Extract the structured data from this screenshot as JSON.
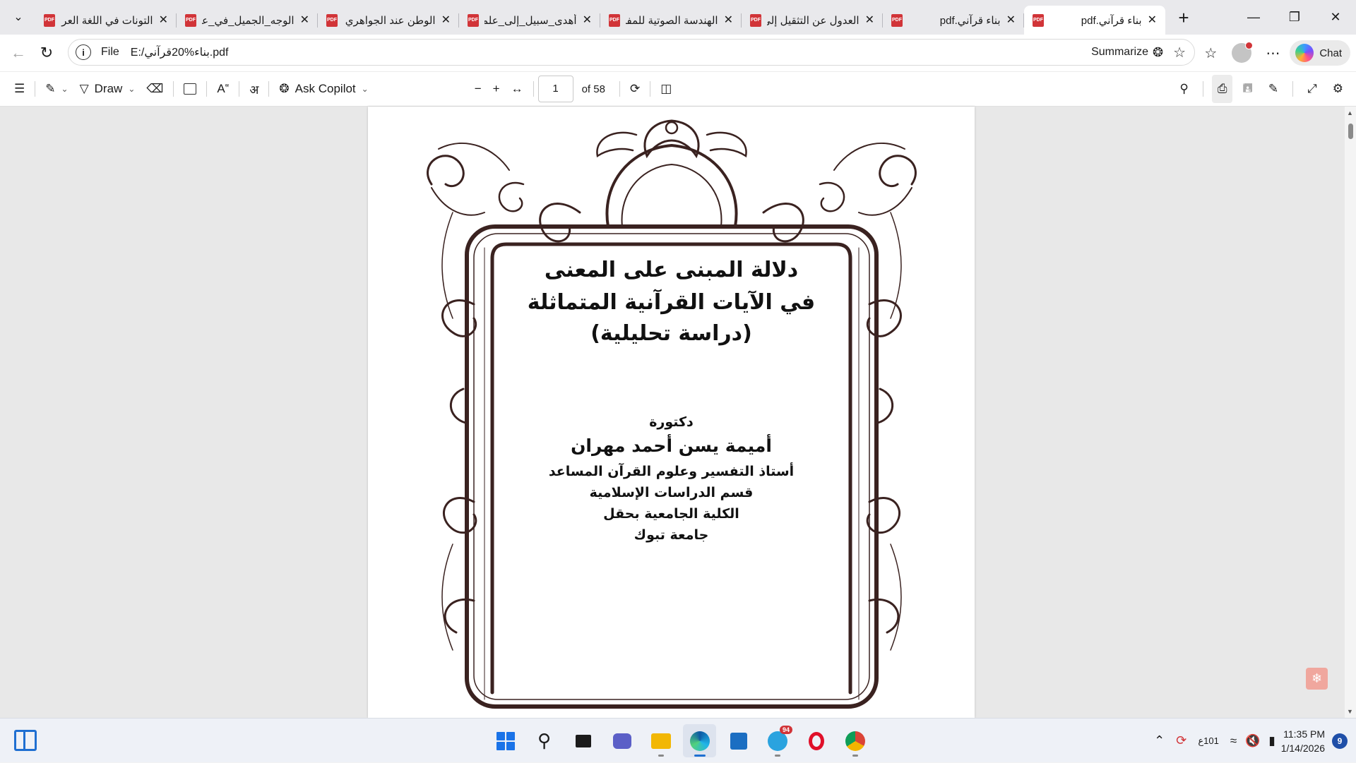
{
  "browser": {
    "tabs": [
      {
        "title": "التونات في اللغة العربية",
        "active": false
      },
      {
        "title": "الوجه_الجميل_في_علم",
        "active": false
      },
      {
        "title": "الوطن عند الجواهري",
        "active": false
      },
      {
        "title": "أهدى_سبيل_إلى_علمي",
        "active": false
      },
      {
        "title": "الهندسة الصوتية للمفردة",
        "active": false
      },
      {
        "title": "العدول عن التثقيل إلى",
        "active": false
      },
      {
        "title": "بناء قرآني.pdf",
        "active": false
      },
      {
        "title": "بناء قرآني.pdf",
        "active": true
      }
    ],
    "tab_icon_text": "PDF",
    "address": {
      "scheme_label": "File",
      "url": "E:/بناء%20قرآني.pdf"
    },
    "summarize_label": "Summarize",
    "chat_label": "Chat"
  },
  "pdf_toolbar": {
    "draw_label": "Draw",
    "ask_copilot_label": "Ask Copilot",
    "current_page": "1",
    "page_count_label": "of 58"
  },
  "document": {
    "title_lines": [
      "دلالة المبنى على المعنى",
      "في الآيات القرآنية المتماثلة",
      "(دراسة تحليلية)"
    ],
    "author_prefix": "دكتورة",
    "author_name": "أميمة يسن أحمد مهران",
    "affiliation_lines": [
      "أستاذ التفسير وعلوم القرآن المساعد",
      "قسم الدراسات الإسلامية",
      "الكلية الجامعية بحقل",
      "جامعة تبوك"
    ]
  },
  "taskbar": {
    "telegram_badge": "94",
    "ime_top": "ع",
    "ime_bottom": "101",
    "time": "11:35 PM",
    "date": "1/14/2026",
    "notification_count": "9"
  },
  "colors": {
    "accent": "#1f6fd1",
    "pdf_red": "#d13438",
    "frame": "#3a2220"
  }
}
